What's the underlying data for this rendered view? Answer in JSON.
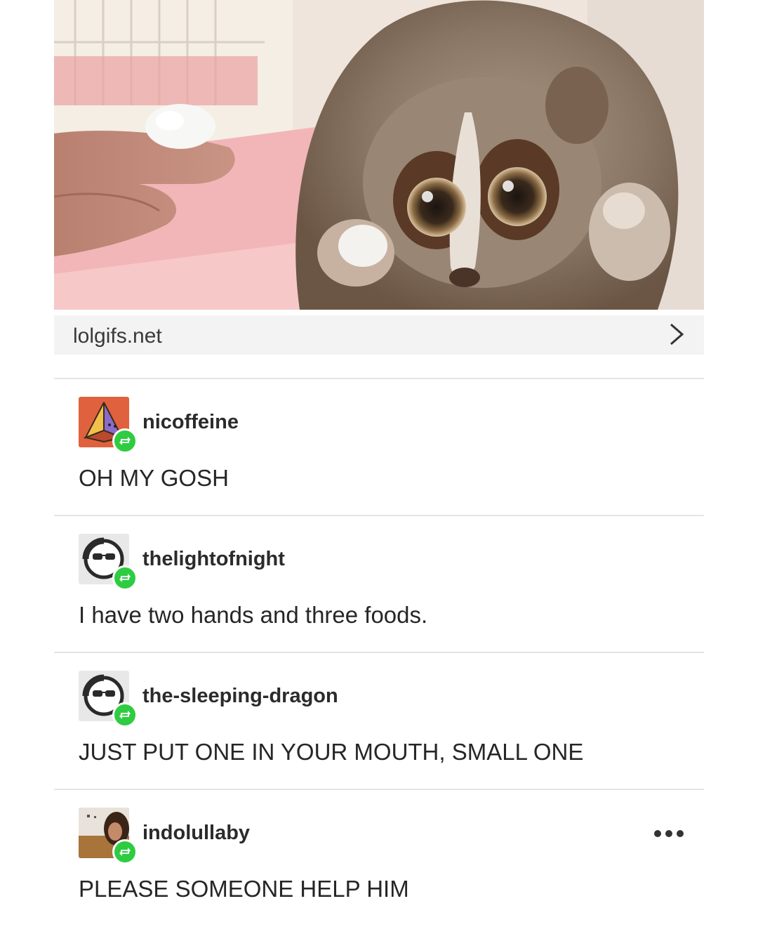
{
  "source": {
    "label": "lolgifs.net",
    "chevron_icon": "chevron-right-icon"
  },
  "reblogs": [
    {
      "username": "nicoffeine",
      "text": "OH MY GOSH",
      "avatar": "pyramid-avatar",
      "avatar_bg": "#e0613d"
    },
    {
      "username": "thelightofnight",
      "text": "I have two hands and three foods.",
      "avatar": "sunglasses-face-avatar",
      "avatar_bg": "#e8e8e8"
    },
    {
      "username": "the-sleeping-dragon",
      "text": "JUST PUT ONE IN YOUR MOUTH, SMALL ONE",
      "avatar": "sunglasses-face-avatar",
      "avatar_bg": "#e8e8e8"
    },
    {
      "username": "indolullaby",
      "text": "PLEASE SOMEONE HELP HIM",
      "avatar": "photo-avatar",
      "avatar_bg": "#c9b8a4"
    }
  ],
  "colors": {
    "reblog_badge": "#2ecc40",
    "source_bar": "#f3f3f3",
    "divider": "#e4e4e4"
  }
}
